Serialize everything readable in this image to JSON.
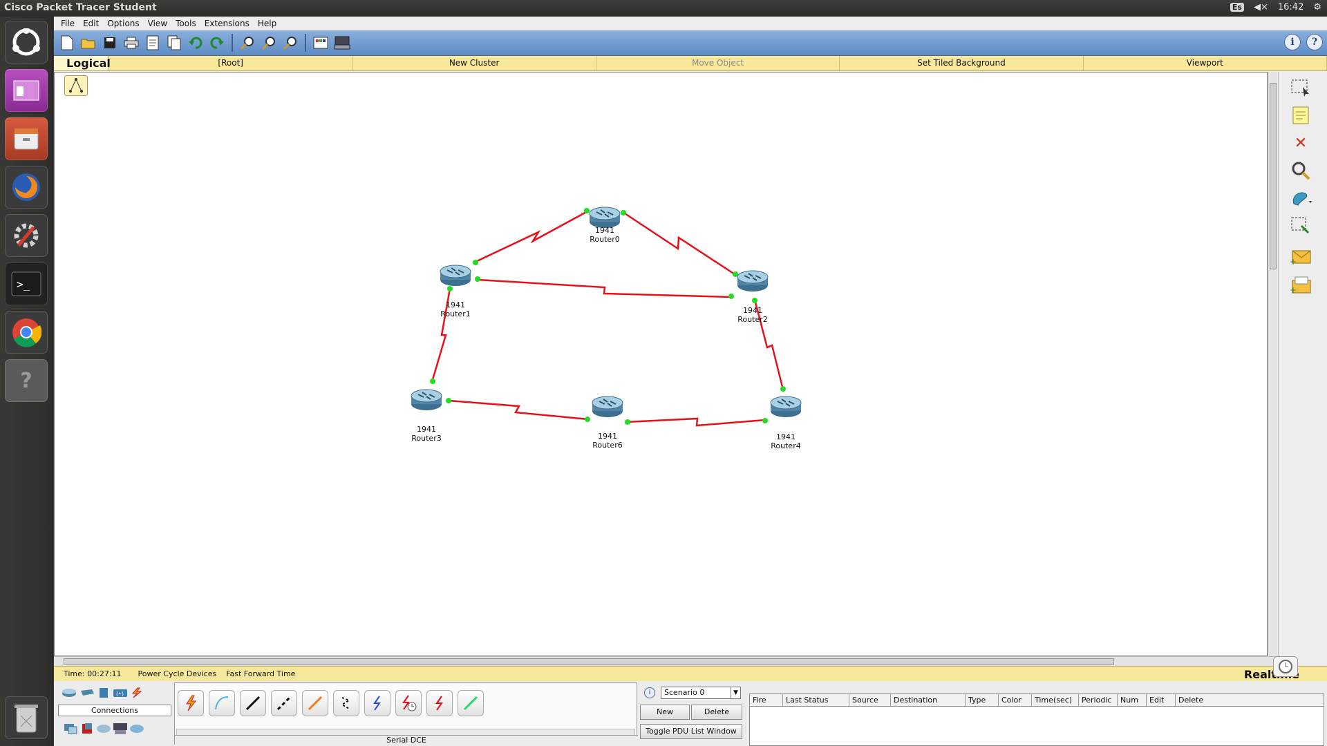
{
  "system": {
    "app_title": "Cisco Packet Tracer Student",
    "keyboard": "Es",
    "volume": "◀×",
    "clock": "16:42",
    "gear": "⚙"
  },
  "menu": [
    "File",
    "Edit",
    "Options",
    "View",
    "Tools",
    "Extensions",
    "Help"
  ],
  "navbar": {
    "logical": "Logical",
    "cells": [
      "[Root]",
      "New Cluster",
      "Move Object",
      "Set Tiled Background",
      "Viewport"
    ]
  },
  "topology": {
    "routers": [
      {
        "model": "1941",
        "name": "Router0"
      },
      {
        "model": "1941",
        "name": "Router1"
      },
      {
        "model": "1941",
        "name": "Router2"
      },
      {
        "model": "1941",
        "name": "Router3"
      },
      {
        "model": "1941",
        "name": "Router6"
      },
      {
        "model": "1941",
        "name": "Router4"
      }
    ],
    "link_color": "#e8111b",
    "port_color": "#22dd22"
  },
  "timebar": {
    "time": "Time: 00:27:11",
    "power_cycle": "Power Cycle Devices",
    "fast_forward": "Fast Forward Time",
    "mode": "Realtime"
  },
  "devices": {
    "category_label": "Connections"
  },
  "cables": {
    "selected_name": "Serial DCE"
  },
  "scenario": {
    "selected": "Scenario 0",
    "new": "New",
    "delete": "Delete",
    "toggle": "Toggle PDU List Window"
  },
  "pdu_columns": [
    "Fire",
    "Last Status",
    "Source",
    "Destination",
    "Type",
    "Color",
    "Time(sec)",
    "Periodic",
    "Num",
    "Edit",
    "Delete"
  ]
}
